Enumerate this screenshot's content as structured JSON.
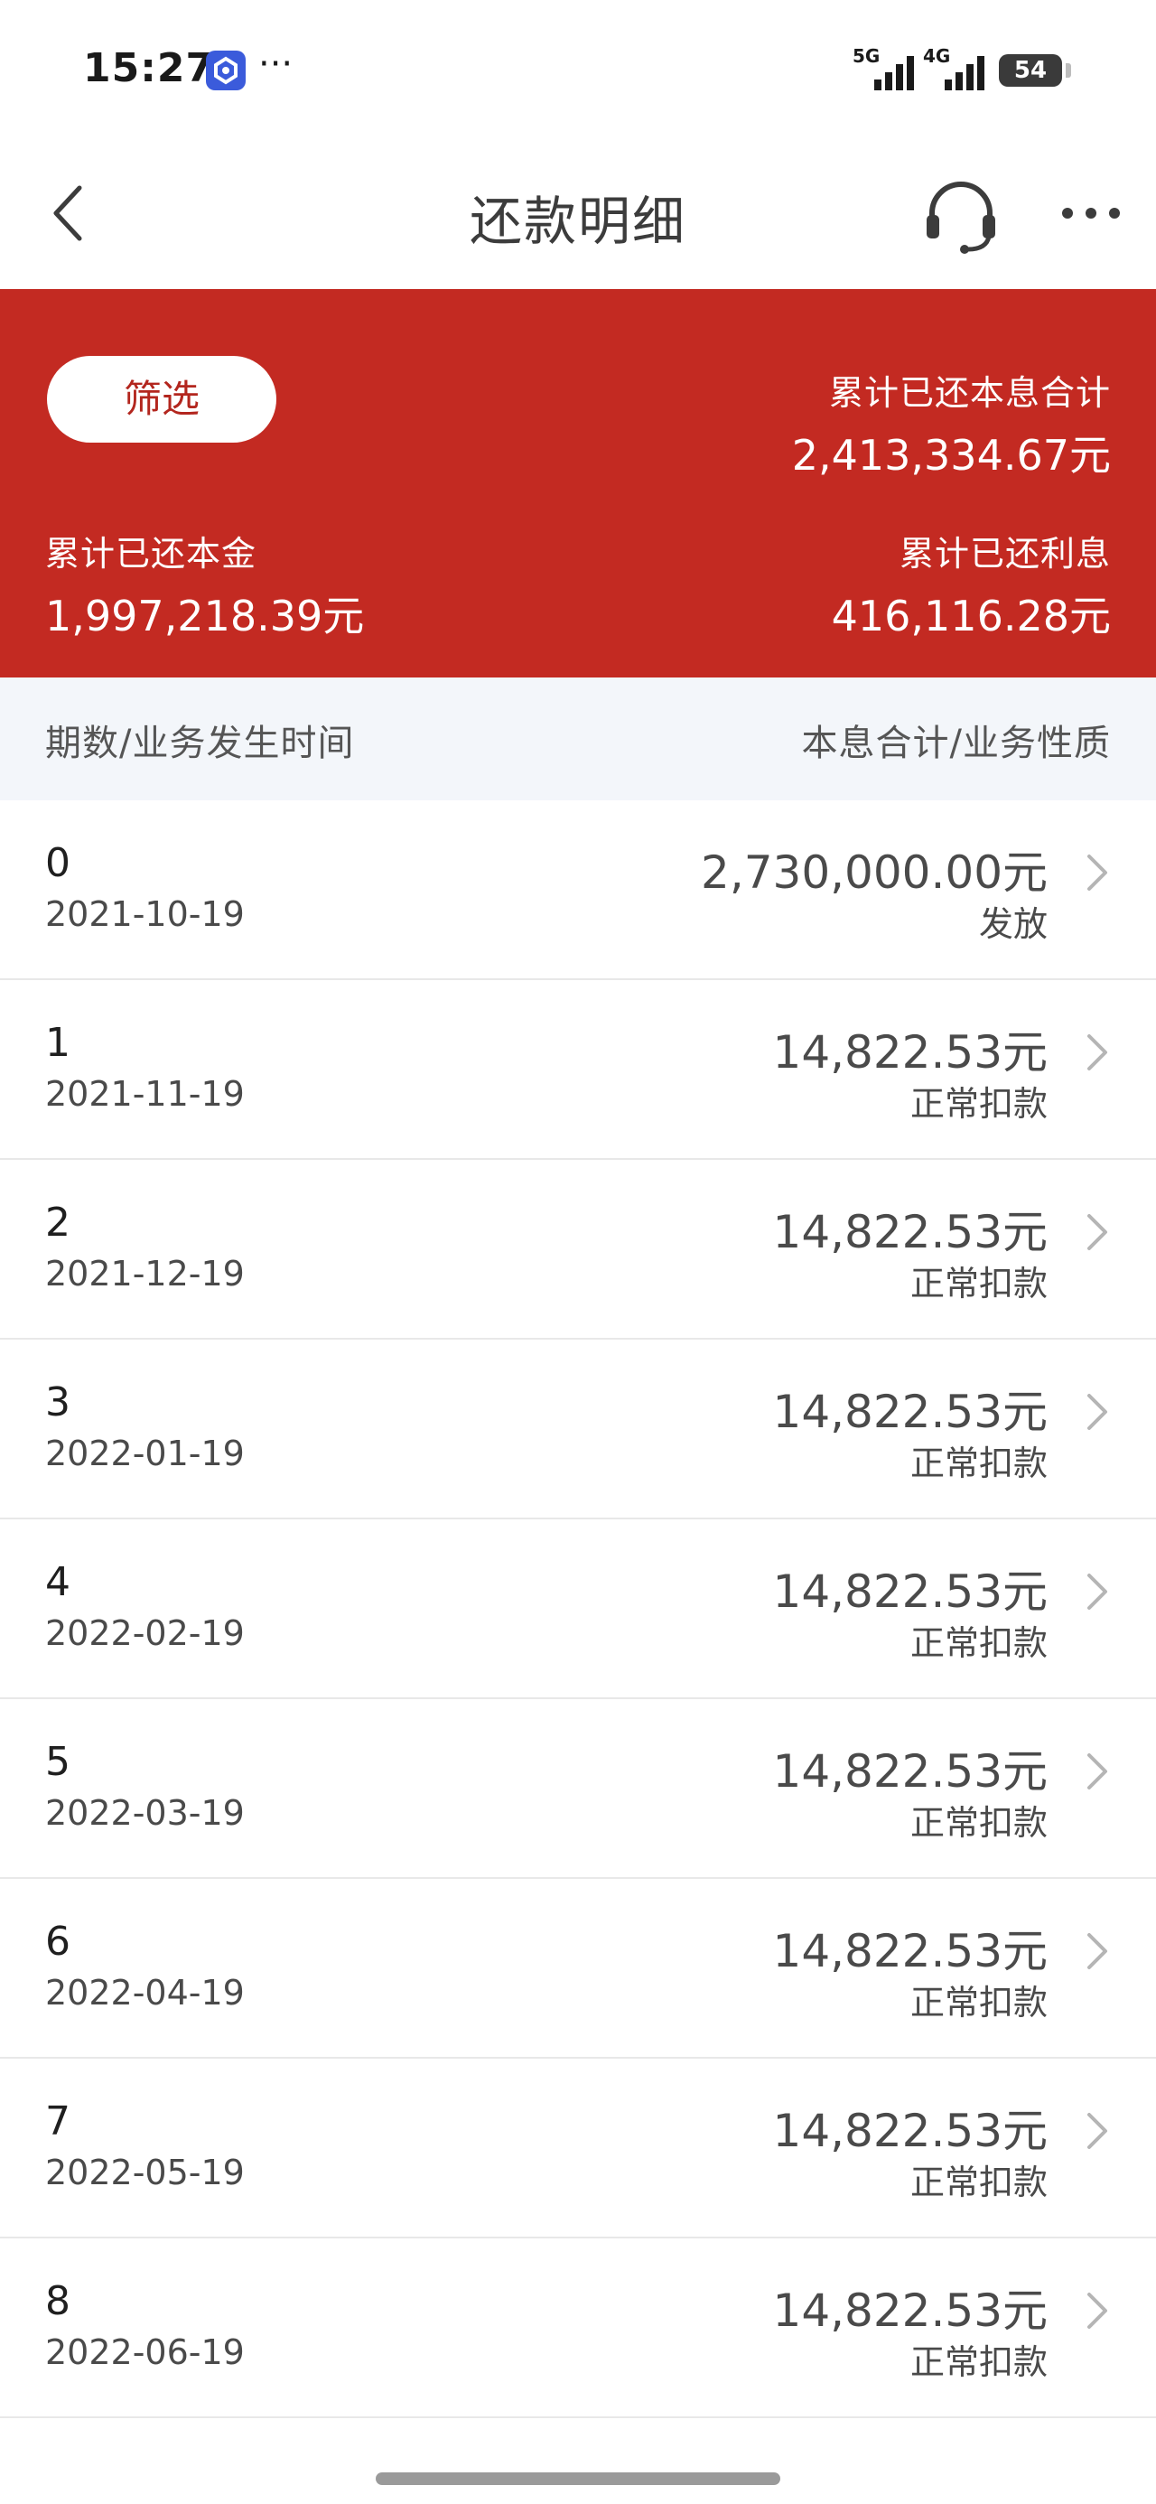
{
  "status_bar": {
    "time": "15:27",
    "dots": "···",
    "signal_1_label": "5G",
    "signal_2_label": "4G",
    "battery": "54"
  },
  "nav": {
    "title": "还款明细",
    "icons": {
      "back": "chevron-left-icon",
      "support": "headset-icon",
      "more": "more-horizontal-icon"
    }
  },
  "summary": {
    "filter_label": "筛选",
    "total_label": "累计已还本息合计",
    "total_value": "2,413,334.67元",
    "principal_label": "累计已还本金",
    "principal_value": "1,997,218.39元",
    "interest_label": "累计已还利息",
    "interest_value": "416,116.28元",
    "background_color": "#c32a22"
  },
  "columns": {
    "left": "期数/业务发生时间",
    "right": "本息合计/业务性质"
  },
  "records": [
    {
      "period": "0",
      "date": "2021-10-19",
      "amount": "2,730,000.00元",
      "type": "发放"
    },
    {
      "period": "1",
      "date": "2021-11-19",
      "amount": "14,822.53元",
      "type": "正常扣款"
    },
    {
      "period": "2",
      "date": "2021-12-19",
      "amount": "14,822.53元",
      "type": "正常扣款"
    },
    {
      "period": "3",
      "date": "2022-01-19",
      "amount": "14,822.53元",
      "type": "正常扣款"
    },
    {
      "period": "4",
      "date": "2022-02-19",
      "amount": "14,822.53元",
      "type": "正常扣款"
    },
    {
      "period": "5",
      "date": "2022-03-19",
      "amount": "14,822.53元",
      "type": "正常扣款"
    },
    {
      "period": "6",
      "date": "2022-04-19",
      "amount": "14,822.53元",
      "type": "正常扣款"
    },
    {
      "period": "7",
      "date": "2022-05-19",
      "amount": "14,822.53元",
      "type": "正常扣款"
    },
    {
      "period": "8",
      "date": "2022-06-19",
      "amount": "14,822.53元",
      "type": "正常扣款"
    }
  ]
}
